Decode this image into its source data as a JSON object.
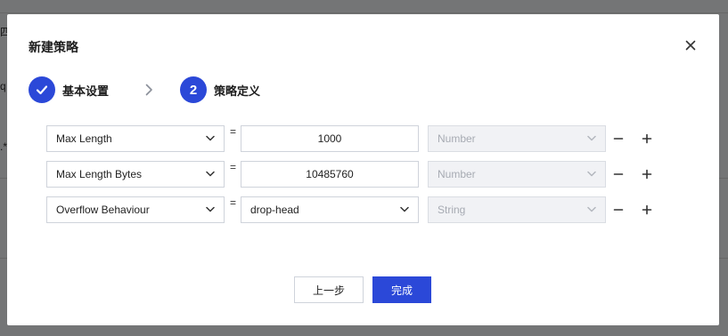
{
  "background": {
    "fragments": [
      "四",
      "q",
      ".*"
    ]
  },
  "modal": {
    "title": "新建策略",
    "close_icon": "close-icon"
  },
  "steps": [
    {
      "label": "基本设置",
      "state": "done",
      "icon": "check-icon"
    },
    {
      "label": "策略定义",
      "state": "active",
      "number": "2"
    }
  ],
  "rows": [
    {
      "key": "Max Length",
      "operator": "=",
      "value": "1000",
      "value_kind": "input",
      "type": "Number"
    },
    {
      "key": "Max Length Bytes",
      "operator": "=",
      "value": "10485760",
      "value_kind": "input",
      "type": "Number"
    },
    {
      "key": "Overflow Behaviour",
      "operator": "=",
      "value": "drop-head",
      "value_kind": "select",
      "type": "String"
    }
  ],
  "footer": {
    "prev_label": "上一步",
    "done_label": "完成"
  },
  "colors": {
    "accent": "#2b48d8",
    "disabled_bg": "#f1f2f5",
    "disabled_text": "#a7abb3",
    "border": "#cfd3db"
  }
}
